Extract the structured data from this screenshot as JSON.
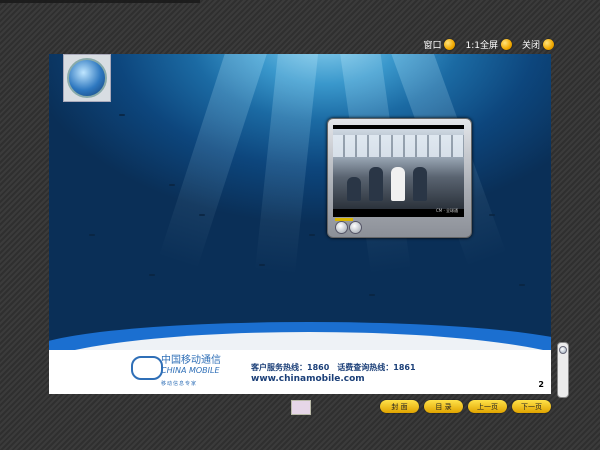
{
  "window": {
    "controls": [
      {
        "label": "窗口",
        "icon": "window-mode-icon"
      },
      {
        "label": "1:1全屏",
        "icon": "fullscreen-icon"
      },
      {
        "label": "关闭",
        "icon": "close-icon"
      }
    ]
  },
  "page": {
    "company_name": "中国移动通信",
    "company_en": "CHINA MOBILE",
    "slogan": "移动信息专家",
    "hotline": "客户服务热线：1860　话费查询热线：1861",
    "url": "www.chinamobile.com",
    "page_number": "2"
  },
  "video": {
    "caption": "CM · 全球通"
  },
  "navigation": [
    {
      "label": "封  面"
    },
    {
      "label": "目  录"
    },
    {
      "label": "上一页"
    },
    {
      "label": "下一页"
    }
  ]
}
